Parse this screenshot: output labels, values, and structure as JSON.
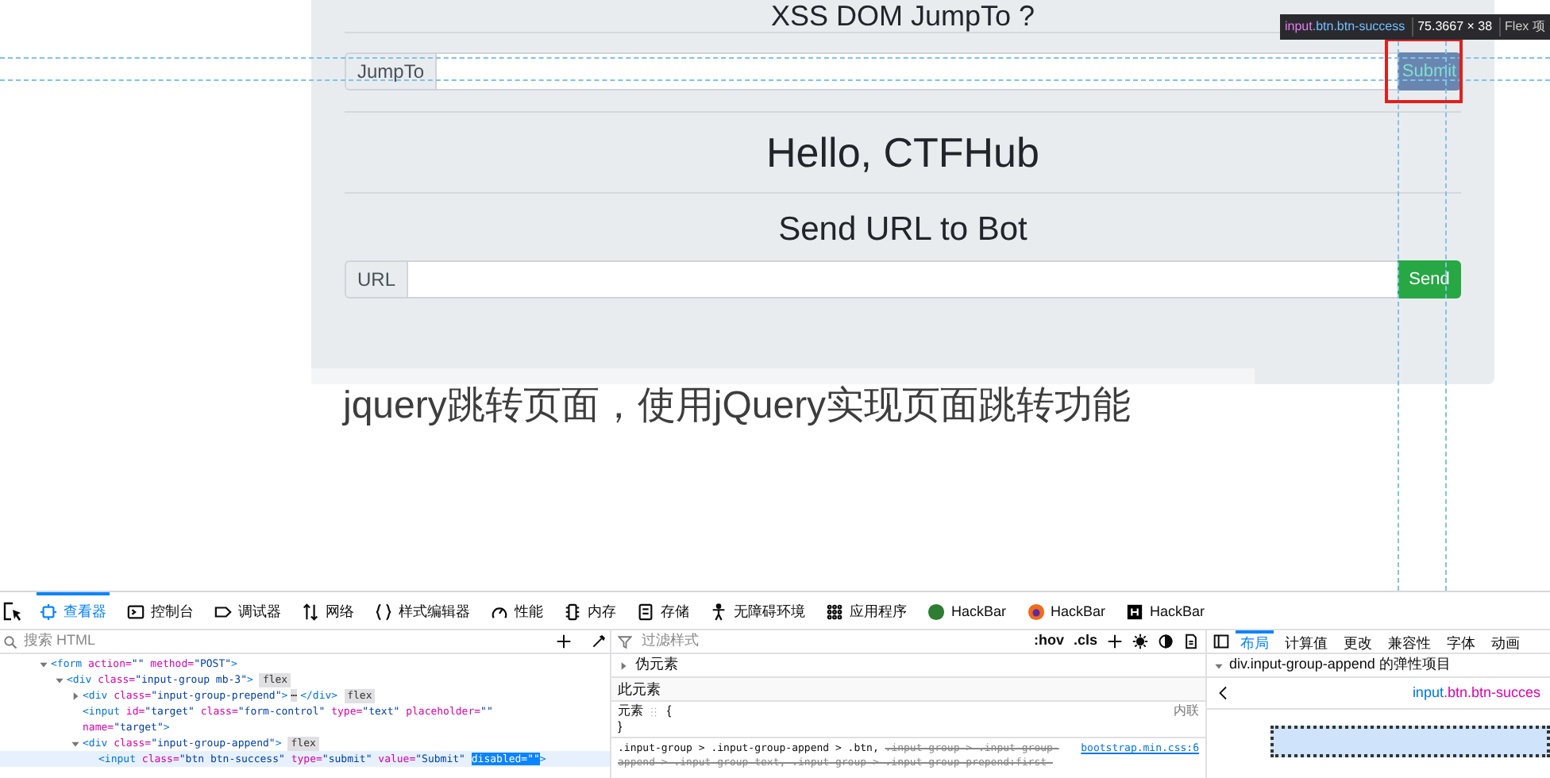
{
  "page": {
    "top_heading": "XSS DOM JumpTo ?",
    "jump": {
      "label": "JumpTo",
      "button": "Submit"
    },
    "heading": "Hello, CTFHub",
    "send": {
      "heading": "Send URL to Bot",
      "label": "URL",
      "button": "Send"
    },
    "article_title": "jquery跳转页面，使用jQuery实现页面跳转功能",
    "tooltip": {
      "tag": "input",
      "classes": ".btn.btn-success",
      "size": "75.3667 × 38",
      "extra": "Flex 项"
    }
  },
  "devtools": {
    "tabs": [
      {
        "label": "查看器",
        "selected": true
      },
      {
        "label": "控制台",
        "selected": false
      },
      {
        "label": "调试器",
        "selected": false
      },
      {
        "label": "网络",
        "selected": false
      },
      {
        "label": "样式编辑器",
        "selected": false
      },
      {
        "label": "性能",
        "selected": false
      },
      {
        "label": "内存",
        "selected": false
      },
      {
        "label": "存储",
        "selected": false
      },
      {
        "label": "无障碍环境",
        "selected": false
      },
      {
        "label": "应用程序",
        "selected": false
      },
      {
        "label": "HackBar",
        "selected": false
      },
      {
        "label": "HackBar",
        "selected": false
      },
      {
        "label": "HackBar",
        "selected": false
      }
    ],
    "html": {
      "search_placeholder": "搜索 HTML",
      "nodes": [
        {
          "text": "<form action=\"\" method=\"POST\">",
          "expanded": true,
          "children": [
            {
              "text": "<div class=\"input-group mb-3\">",
              "badge": "flex",
              "expanded": true,
              "children": [
                {
                  "text": "<div class=\"input-group-prepend\">",
                  "ellipsis": "⋯",
                  "tail": "</div>",
                  "badge": "flex",
                  "expanded": false
                },
                {
                  "text": "<input id=\"target\" class=\"form-control\" type=\"text\" placeholder=\"\"",
                  "continuation": "name=\"target\">"
                },
                {
                  "text": "<div class=\"input-group-append\">",
                  "badge": "flex",
                  "expanded": true,
                  "children": [
                    {
                      "text": "<input class=\"btn btn-success\" type=\"submit\" value=\"Submit\"",
                      "highlight": "disabled=\"\"",
                      "tail": ">",
                      "selected": true
                    }
                  ]
                }
              ]
            }
          ]
        }
      ]
    },
    "rules": {
      "filter_placeholder": "过滤样式",
      "buttons": [
        ":hov",
        ".cls"
      ],
      "pseudo": {
        "label": "伪元素",
        "expanded": false
      },
      "this_element": "此元素",
      "element_rule": "元素",
      "open_brace": "{",
      "close_brace": "}",
      "inline": "内联",
      "selector": ".input-group > .input-group-append > .btn,",
      "overridden": ".input-group > .input-group-append > .input-group-text, .input-group > .input-group-prepend:first-",
      "source": "bootstrap.min.css:6"
    },
    "layout": {
      "tabs": [
        {
          "label": "布局",
          "selected": true
        },
        {
          "label": "计算值",
          "selected": false
        },
        {
          "label": "更改",
          "selected": false
        },
        {
          "label": "兼容性",
          "selected": false
        },
        {
          "label": "字体",
          "selected": false
        },
        {
          "label": "动画",
          "selected": false
        }
      ],
      "section": "div.input-group-append 的弹性项目",
      "nav_tag": "input",
      "nav_classes": ".btn.btn-succes"
    }
  }
}
